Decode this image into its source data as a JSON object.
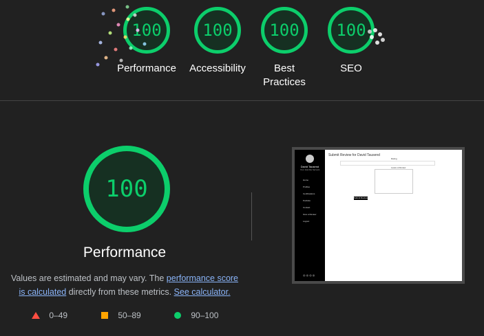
{
  "gauges": [
    {
      "score": "100",
      "label": "Performance"
    },
    {
      "score": "100",
      "label": "Accessibility"
    },
    {
      "score": "100",
      "label": "Best Practices"
    },
    {
      "score": "100",
      "label": "SEO"
    }
  ],
  "main": {
    "score": "100",
    "title": "Performance",
    "desc_prefix": "Values are estimated and may vary. The ",
    "link_score": "performance score is calculated",
    "desc_middle": " directly from these metrics. ",
    "link_calc": "See calculator."
  },
  "legend": [
    {
      "range": "0–49",
      "color": "#ff4e42",
      "icon": "triangle-icon"
    },
    {
      "range": "50–89",
      "color": "#ffa400",
      "icon": "square-icon"
    },
    {
      "range": "90–100",
      "color": "#0cce6b",
      "icon": "circle-icon"
    }
  ],
  "screenshot": {
    "page_title": "Submit Review for David Tausend",
    "name": "David Tausend",
    "role": "Your Humble Servant",
    "nav": [
      "Home",
      "Profiles",
      "Certifications",
      "Portfolio",
      "Contact",
      "Give a Review",
      "Logout"
    ],
    "rating_label": "Rating",
    "review_label": "Leave a Review",
    "button": "Submit Review"
  }
}
